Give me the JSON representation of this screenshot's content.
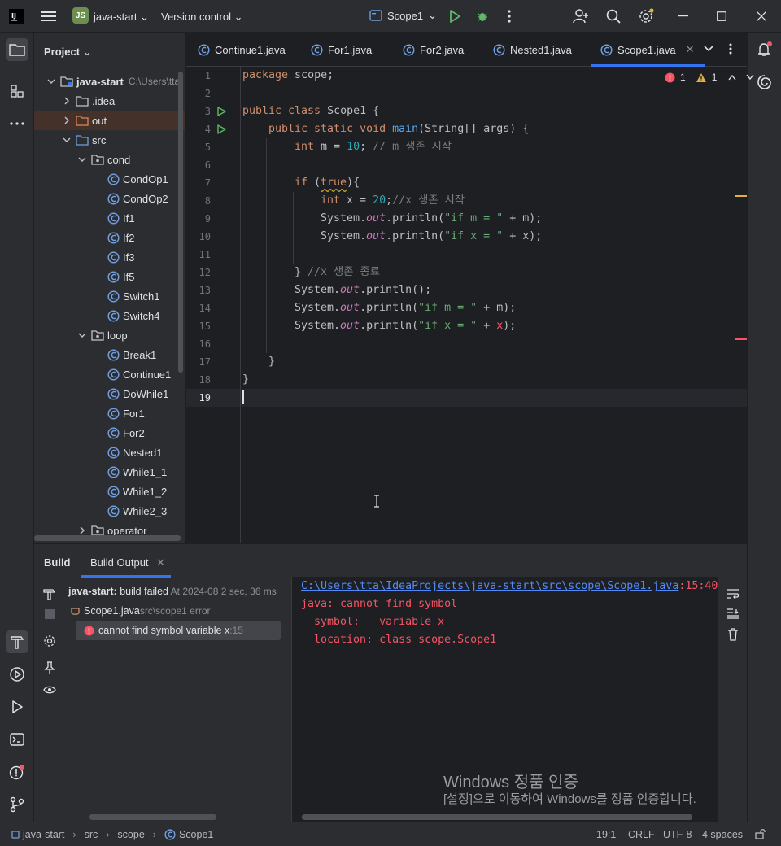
{
  "titlebar": {
    "project_badge": "JS",
    "project_name": "java-start",
    "vcs": "Version control",
    "run_config": "Scope1"
  },
  "project_panel": {
    "title": "Project",
    "tree": [
      {
        "label": "java-start",
        "path": "C:\\Users\\tta",
        "bold": true,
        "icon": "module-folder-icon",
        "depth": 0,
        "expanded": true
      },
      {
        "label": ".idea",
        "icon": "folder-icon",
        "depth": 1,
        "expanded": false
      },
      {
        "label": "out",
        "icon": "excluded-folder-icon",
        "depth": 1,
        "expanded": false,
        "selected": true
      },
      {
        "label": "src",
        "icon": "source-folder-icon",
        "depth": 1,
        "expanded": true
      },
      {
        "label": "cond",
        "icon": "package-icon",
        "depth": 2,
        "expanded": true
      },
      {
        "label": "CondOp1",
        "icon": "java-class-icon",
        "depth": 3
      },
      {
        "label": "CondOp2",
        "icon": "java-class-icon",
        "depth": 3
      },
      {
        "label": "If1",
        "icon": "java-class-icon",
        "depth": 3
      },
      {
        "label": "If2",
        "icon": "java-class-icon",
        "depth": 3
      },
      {
        "label": "If3",
        "icon": "java-class-icon",
        "depth": 3
      },
      {
        "label": "If5",
        "icon": "java-class-icon",
        "depth": 3
      },
      {
        "label": "Switch1",
        "icon": "java-class-icon",
        "depth": 3
      },
      {
        "label": "Switch4",
        "icon": "java-class-icon",
        "depth": 3
      },
      {
        "label": "loop",
        "icon": "package-icon",
        "depth": 2,
        "expanded": true
      },
      {
        "label": "Break1",
        "icon": "java-class-icon",
        "depth": 3
      },
      {
        "label": "Continue1",
        "icon": "java-class-icon",
        "depth": 3
      },
      {
        "label": "DoWhile1",
        "icon": "java-class-icon",
        "depth": 3
      },
      {
        "label": "For1",
        "icon": "java-class-icon",
        "depth": 3
      },
      {
        "label": "For2",
        "icon": "java-class-icon",
        "depth": 3
      },
      {
        "label": "Nested1",
        "icon": "java-class-icon",
        "depth": 3
      },
      {
        "label": "While1_1",
        "icon": "java-class-icon",
        "depth": 3
      },
      {
        "label": "While1_2",
        "icon": "java-class-icon",
        "depth": 3
      },
      {
        "label": "While2_3",
        "icon": "java-class-icon",
        "depth": 3
      },
      {
        "label": "operator",
        "icon": "package-icon",
        "depth": 2,
        "expanded": false
      }
    ]
  },
  "tabs": [
    {
      "label": "Continue1.java",
      "active": false
    },
    {
      "label": "For1.java",
      "active": false
    },
    {
      "label": "For2.java",
      "active": false
    },
    {
      "label": "Nested1.java",
      "active": false
    },
    {
      "label": "Scope1.java",
      "active": true
    }
  ],
  "inspections": {
    "errors": "1",
    "warnings": "1"
  },
  "code_lines": [
    "1",
    "2",
    "3",
    "4",
    "5",
    "6",
    "7",
    "8",
    "9",
    "10",
    "11",
    "12",
    "13",
    "14",
    "15",
    "16",
    "17",
    "18",
    "19"
  ],
  "code": {
    "l1_kw": "package",
    "l1_rest": " scope;",
    "l3_kw": "public class",
    "l3_rest": " Scope1 {",
    "l4_kw": "public static void",
    "l4_fn": "main",
    "l4_rest": "(String[] args) {",
    "l5_kw": "int",
    "l5_mid": " m = ",
    "l5_num": "10",
    "l5_semi": "; ",
    "l5_cm": "// m 생존 시작",
    "l7_kw": "if",
    "l7_a": " (",
    "l7_true": "true",
    "l7_b": "){",
    "l8_kw": "int",
    "l8_mid": " x = ",
    "l8_num": "20",
    "l8_semi": ";",
    "l8_cm": "//x 생존 시작",
    "l9_a": "System.",
    "l9_out": "out",
    "l9_b": ".println(",
    "l9_str": "\"if m = \"",
    "l9_c": " + m);",
    "l10_a": "System.",
    "l10_out": "out",
    "l10_b": ".println(",
    "l10_str": "\"if x = \"",
    "l10_c": " + x);",
    "l12_a": "} ",
    "l12_cm": "//x 생존 종료",
    "l13_a": "System.",
    "l13_out": "out",
    "l13_b": ".println();",
    "l14_a": "System.",
    "l14_out": "out",
    "l14_b": ".println(",
    "l14_str": "\"if m = \"",
    "l14_c": " + m);",
    "l15_a": "System.",
    "l15_out": "out",
    "l15_b": ".println(",
    "l15_str": "\"if x = \"",
    "l15_c": " + ",
    "l15_err": "x",
    "l15_d": ");",
    "l17": "}",
    "l18": "}"
  },
  "bottom": {
    "tab_build": "Build",
    "tab_output": "Build Output",
    "tree": {
      "root_name": "java-start:",
      "root_status": " build failed",
      "root_time": " At 2024-08 2 sec, 36 ms",
      "file": "Scope1.java",
      "file_path": " src\\scope",
      "file_count": " 1 error",
      "error": "cannot find symbol variable x",
      "error_line": " :15"
    },
    "output": {
      "link": "C:\\Users\\tta\\IdeaProjects\\java-start\\src\\scope\\Scope1.java",
      "link_pos": ":15:40",
      "line1": "java: cannot find symbol",
      "line2": "  symbol:   variable x",
      "line3": "  location: class scope.Scope1"
    }
  },
  "watermark": {
    "title": "Windows 정품 인증",
    "body": "[설정]으로 이동하여 Windows를 정품 인증합니다."
  },
  "status": {
    "crumbs": [
      "java-start",
      "src",
      "scope",
      "Scope1"
    ],
    "position": "19:1",
    "line_sep": "CRLF",
    "encoding": "UTF-8",
    "indent": "4 spaces"
  },
  "colors": {
    "accent": "#3574f0",
    "error": "#f75464",
    "run_green": "#5fb865",
    "warning": "#e0b046"
  }
}
